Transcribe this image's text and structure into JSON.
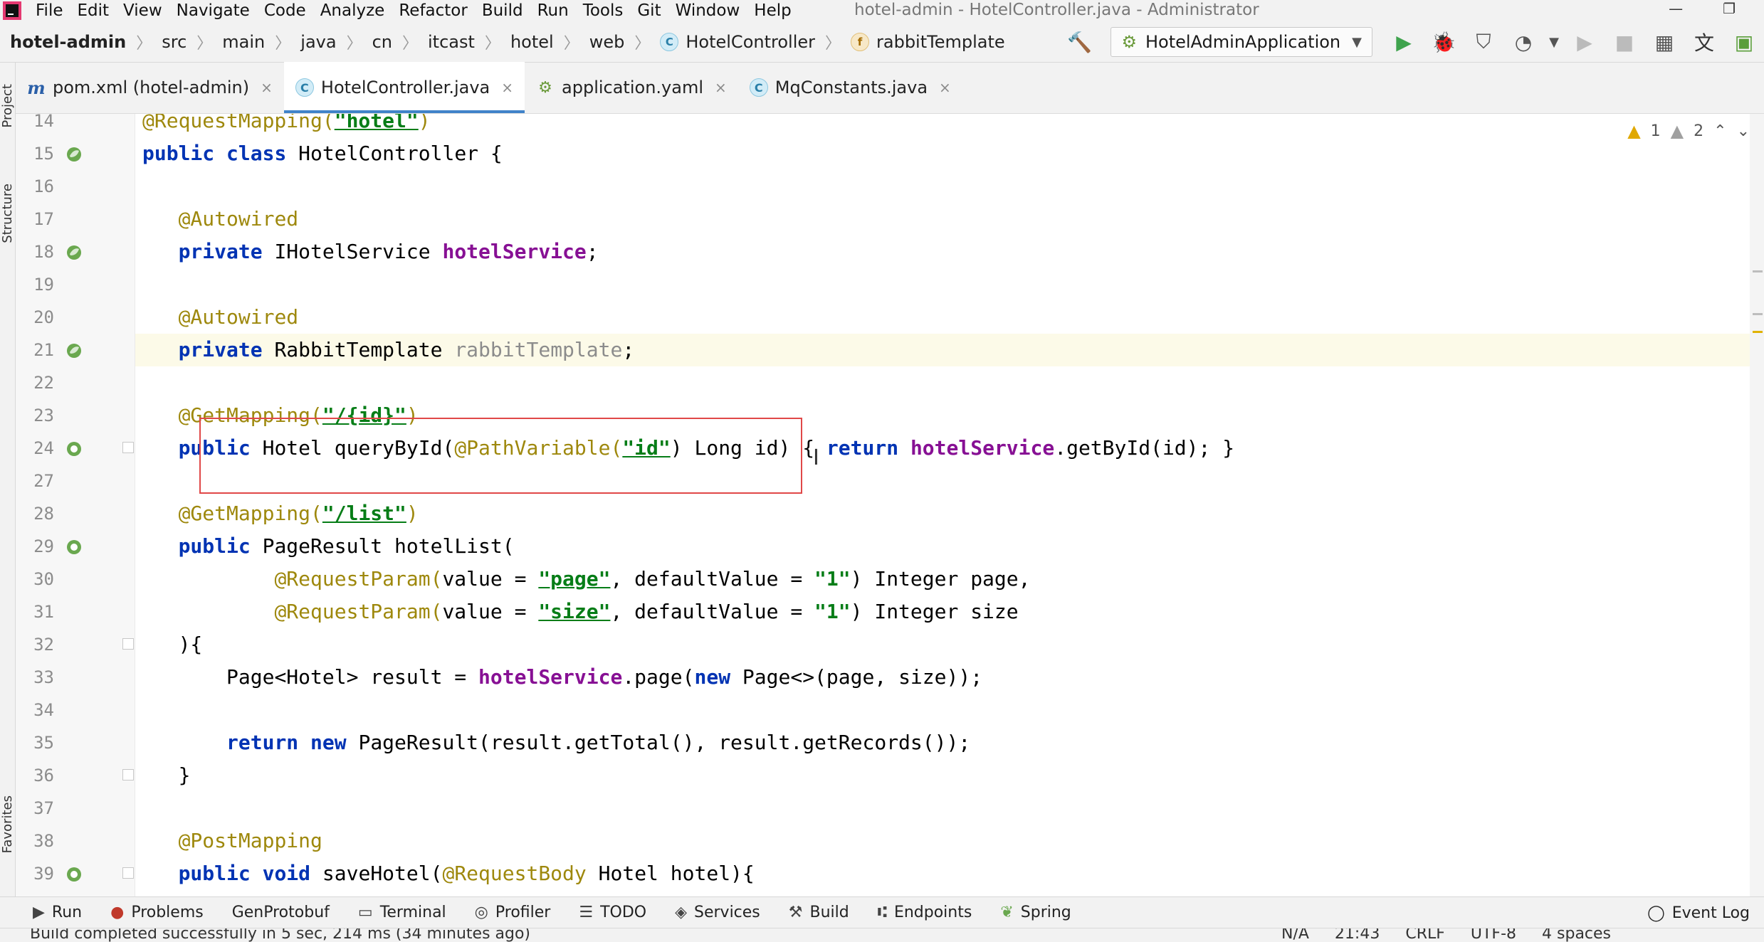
{
  "menu": {
    "items": [
      "File",
      "Edit",
      "View",
      "Navigate",
      "Code",
      "Analyze",
      "Refactor",
      "Build",
      "Run",
      "Tools",
      "Git",
      "Window",
      "Help"
    ],
    "window_title": "hotel-admin - HotelController.java - Administrator"
  },
  "breadcrumb": {
    "items": [
      "hotel-admin",
      "src",
      "main",
      "java",
      "cn",
      "itcast",
      "hotel",
      "web",
      "HotelController",
      "rabbitTemplate"
    ]
  },
  "run_config": {
    "label": "HotelAdminApplication"
  },
  "left_strip": {
    "project": "Project",
    "structure": "Structure",
    "favorites": "Favorites"
  },
  "tabs": [
    {
      "label": "pom.xml (hotel-admin)",
      "icon": "m",
      "active": false
    },
    {
      "label": "HotelController.java",
      "icon": "c",
      "active": true
    },
    {
      "label": "application.yaml",
      "icon": "yaml",
      "active": false
    },
    {
      "label": "MqConstants.java",
      "icon": "c",
      "active": false
    }
  ],
  "inspections": {
    "warnings": "1",
    "weak_warnings": "2"
  },
  "editor": {
    "lines": [
      {
        "num": "14",
        "bean": false
      },
      {
        "num": "15",
        "bean": true
      },
      {
        "num": "16",
        "bean": false
      },
      {
        "num": "17",
        "bean": false
      },
      {
        "num": "18",
        "bean": true
      },
      {
        "num": "19",
        "bean": false
      },
      {
        "num": "20",
        "bean": false
      },
      {
        "num": "21",
        "bean": true
      },
      {
        "num": "22",
        "bean": false
      },
      {
        "num": "23",
        "bean": false
      },
      {
        "num": "24",
        "bean": true
      },
      {
        "num": "27",
        "bean": false
      },
      {
        "num": "28",
        "bean": false
      },
      {
        "num": "29",
        "bean": true
      },
      {
        "num": "30",
        "bean": false
      },
      {
        "num": "31",
        "bean": false
      },
      {
        "num": "32",
        "bean": false
      },
      {
        "num": "33",
        "bean": false
      },
      {
        "num": "34",
        "bean": false
      },
      {
        "num": "35",
        "bean": false
      },
      {
        "num": "36",
        "bean": false
      },
      {
        "num": "37",
        "bean": false
      },
      {
        "num": "38",
        "bean": false
      },
      {
        "num": "39",
        "bean": true
      }
    ],
    "code": {
      "l14_ann": "@RequestMapping(",
      "l14_str": "\"hotel\"",
      "l14_end": ")",
      "l15_kw1": "public",
      "l15_kw2": "class",
      "l15_rest": "HotelController {",
      "l17_ann": "@Autowired",
      "l18_kw": "private",
      "l18_type": "IHotelService",
      "l18_field": "hotelService",
      "l18_end": ";",
      "l20_ann": "@Autowired",
      "l21_kw": "private",
      "l21_type": "RabbitTemplate",
      "l21_field": "rabbitTemplate",
      "l21_end": ";",
      "l23_ann": "@GetMapping(",
      "l23_str": "\"/{id}\"",
      "l23_end": ")",
      "l24_kw": "public",
      "l24_a": "Hotel queryById(",
      "l24_ann": "@PathVariable(",
      "l24_str": "\"id\"",
      "l24_b": ") Long id) { ",
      "l24_ret": "return",
      "l24_field": "hotelService",
      "l24_c": ".getById(id); }",
      "l28_ann": "@GetMapping(",
      "l28_str": "\"/list\"",
      "l28_end": ")",
      "l29_kw": "public",
      "l29_rest": "PageResult hotelList(",
      "l30_ann": "@RequestParam(",
      "l30_a": "value = ",
      "l30_str1": "\"page\"",
      "l30_b": ", defaultValue = ",
      "l30_str2": "\"1\"",
      "l30_c": ") Integer page,",
      "l31_ann": "@RequestParam(",
      "l31_a": "value = ",
      "l31_str1": "\"size\"",
      "l31_b": ", defaultValue = ",
      "l31_str2": "\"1\"",
      "l31_c": ") Integer size",
      "l32": "){",
      "l33_a": "Page<Hotel> result = ",
      "l33_field": "hotelService",
      "l33_b": ".page(",
      "l33_kw": "new",
      "l33_c": " Page<>(page, size));",
      "l35_kw1": "return",
      "l35_kw2": "new",
      "l35_rest": "PageResult(result.getTotal(), result.getRecords());",
      "l36": "}",
      "l38_ann": "@PostMapping",
      "l39_kw1": "public",
      "l39_kw2": "void",
      "l39_a": "saveHotel(",
      "l39_ann": "@RequestBody",
      "l39_b": " Hotel hotel){"
    }
  },
  "tool_windows": [
    "Run",
    "Problems",
    "GenProtobuf",
    "Terminal",
    "Profiler",
    "TODO",
    "Services",
    "Build",
    "Endpoints",
    "Spring"
  ],
  "event_log": "Event Log",
  "status": {
    "message": "Build completed successfully in 5 sec, 214 ms (34 minutes ago)",
    "right": [
      "N/A",
      "21:43",
      "CRLF",
      "UTF-8",
      "4 spaces"
    ]
  }
}
